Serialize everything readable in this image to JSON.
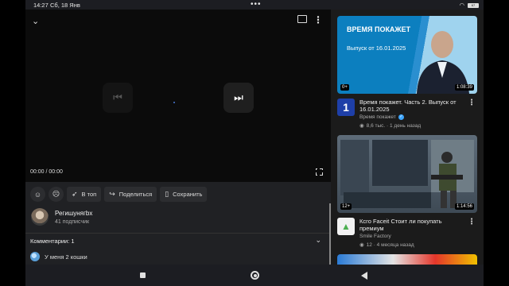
{
  "status": {
    "time": "14:27",
    "date": "Сб, 18 Янв",
    "battery": "67"
  },
  "player": {
    "timecode": "00:00 / 00:00"
  },
  "actions": {
    "share_to_top": "В топ",
    "share": "Поделиться",
    "save": "Сохранить"
  },
  "channel": {
    "name": "Регишунягbx",
    "subscribers": "41 подписчик"
  },
  "comments": {
    "title": "Комментарии: 1",
    "first_comment": "У меня 2 кошки"
  },
  "feed": [
    {
      "thumb_title": "ВРЕМЯ ПОКАЖЕТ",
      "thumb_subtitle": "Выпуск от 16.01.2025",
      "age_rating": "0+",
      "duration": "1:08:39",
      "title": "Время покажет. Часть 2. Выпуск от 16.01.2025",
      "channel": "Время покажет",
      "stats": "8,6 тыс. · 1 день назад"
    },
    {
      "age_rating": "12+",
      "duration": "1:14:56",
      "title": "Ксго Faceit Стоит ли покупать премиум",
      "channel": "Smile Factory",
      "stats": "12 · 4 месяца назад"
    }
  ],
  "icons": {
    "accent": "#3ea6ff"
  }
}
